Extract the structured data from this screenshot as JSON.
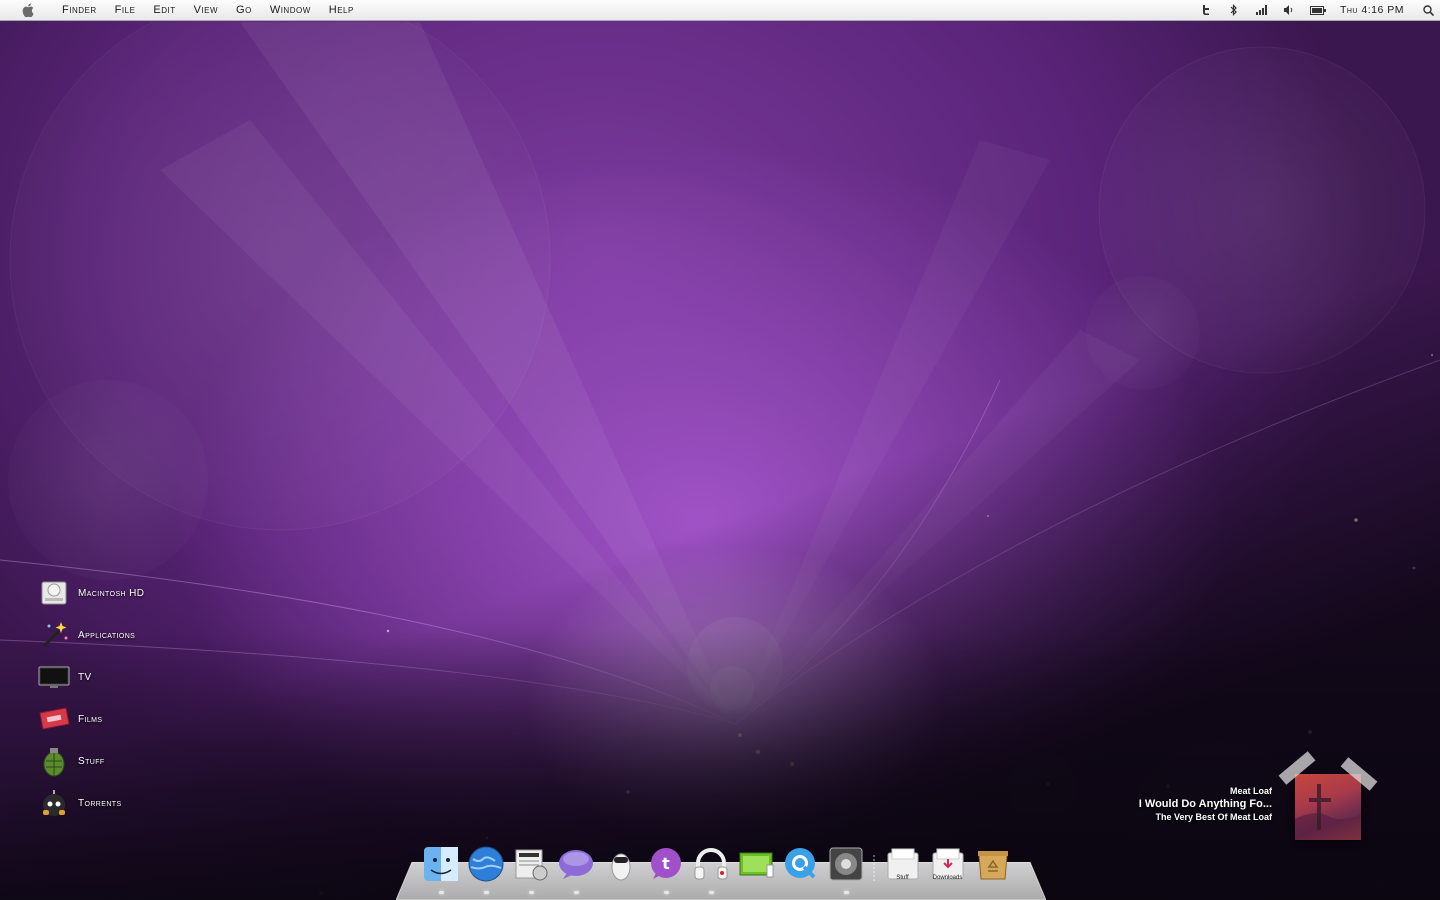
{
  "menubar": {
    "app_name": "Finder",
    "menus": [
      "File",
      "Edit",
      "View",
      "Go",
      "Window",
      "Help"
    ],
    "status_icons": [
      "twitter-icon",
      "bluetooth-icon",
      "signal-icon",
      "volume-icon",
      "battery-icon"
    ],
    "clock": "Thu 4:16 PM"
  },
  "desktop": {
    "icons": [
      {
        "label": "Macintosh HD",
        "icon": "hard-drive-icon"
      },
      {
        "label": "Applications",
        "icon": "magic-wand-icon"
      },
      {
        "label": "TV",
        "icon": "tv-icon"
      },
      {
        "label": "Films",
        "icon": "ticket-icon"
      },
      {
        "label": "Stuff",
        "icon": "grenade-icon"
      },
      {
        "label": "Torrents",
        "icon": "bomb-icon"
      }
    ]
  },
  "now_playing": {
    "artist": "Meat Loaf",
    "track": "I Would Do Anything Fo...",
    "album": "The Very Best Of Meat Loaf"
  },
  "dock": {
    "apps": [
      "finder-icon",
      "globe-browser-icon",
      "newspaper-icon",
      "chat-bubble-icon",
      "robot-icon",
      "twitter-bubble-icon",
      "headphones-icon",
      "screen-icon",
      "quicktime-icon",
      "system-preferences-icon"
    ],
    "stacks": [
      {
        "label": "Stuff",
        "icon": "stuff-folder-icon"
      },
      {
        "label": "Downloads",
        "icon": "downloads-folder-icon"
      }
    ],
    "trash": "recycle-bin-icon"
  },
  "colors": {
    "wallpaper_primary": "#7a3b9c",
    "wallpaper_glow": "#e1aaff",
    "wallpaper_dark": "#160b1f",
    "menubar": "#f3f3f3"
  }
}
